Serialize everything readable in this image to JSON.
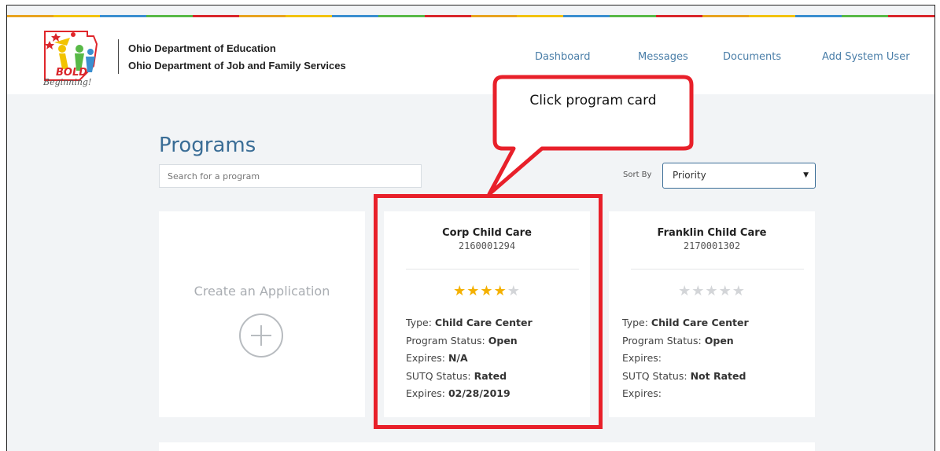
{
  "header": {
    "logo": {
      "text_line1": "BOLD",
      "text_line2": "Beginning!"
    },
    "agency_line1": "Ohio Department of Education",
    "agency_line2": "Ohio Department of Job and Family Services",
    "nav": [
      {
        "label": "Dashboard"
      },
      {
        "label": "Messages"
      },
      {
        "label": "Documents"
      },
      {
        "label": "Add System User"
      }
    ]
  },
  "main": {
    "title": "Programs",
    "search_placeholder": "Search for a program",
    "sort_label": "Sort By",
    "sort_value": "Priority"
  },
  "create_card": {
    "label": "Create an Application"
  },
  "programs": [
    {
      "name": "Corp Child Care",
      "id": "2160001294",
      "rating": 4,
      "max_rating": 5,
      "type_label": "Type:",
      "type_value": "Child Care Center",
      "status_label": "Program Status:",
      "status_value": "Open",
      "expires_label": "Expires:",
      "expires_value": "N/A",
      "sutq_label": "SUTQ Status:",
      "sutq_value": "Rated",
      "sutq_expires_label": "Expires:",
      "sutq_expires_value": "02/28/2019"
    },
    {
      "name": "Franklin Child Care",
      "id": "2170001302",
      "rating": 0,
      "max_rating": 5,
      "type_label": "Type:",
      "type_value": "Child Care Center",
      "status_label": "Program Status:",
      "status_value": "Open",
      "expires_label": "Expires:",
      "expires_value": "",
      "sutq_label": "SUTQ Status:",
      "sutq_value": "Not Rated",
      "sutq_expires_label": "Expires:",
      "sutq_expires_value": ""
    }
  ],
  "annotation": {
    "callout_text": "Click program card"
  },
  "colors": {
    "accent": "#3a6d96",
    "star_filled": "#f4b000",
    "star_empty": "#d3d5d8",
    "highlight": "#e8202a",
    "stripe": [
      "#e8a320",
      "#f2c300",
      "#3a8fd0",
      "#58b947",
      "#d9262b"
    ]
  }
}
